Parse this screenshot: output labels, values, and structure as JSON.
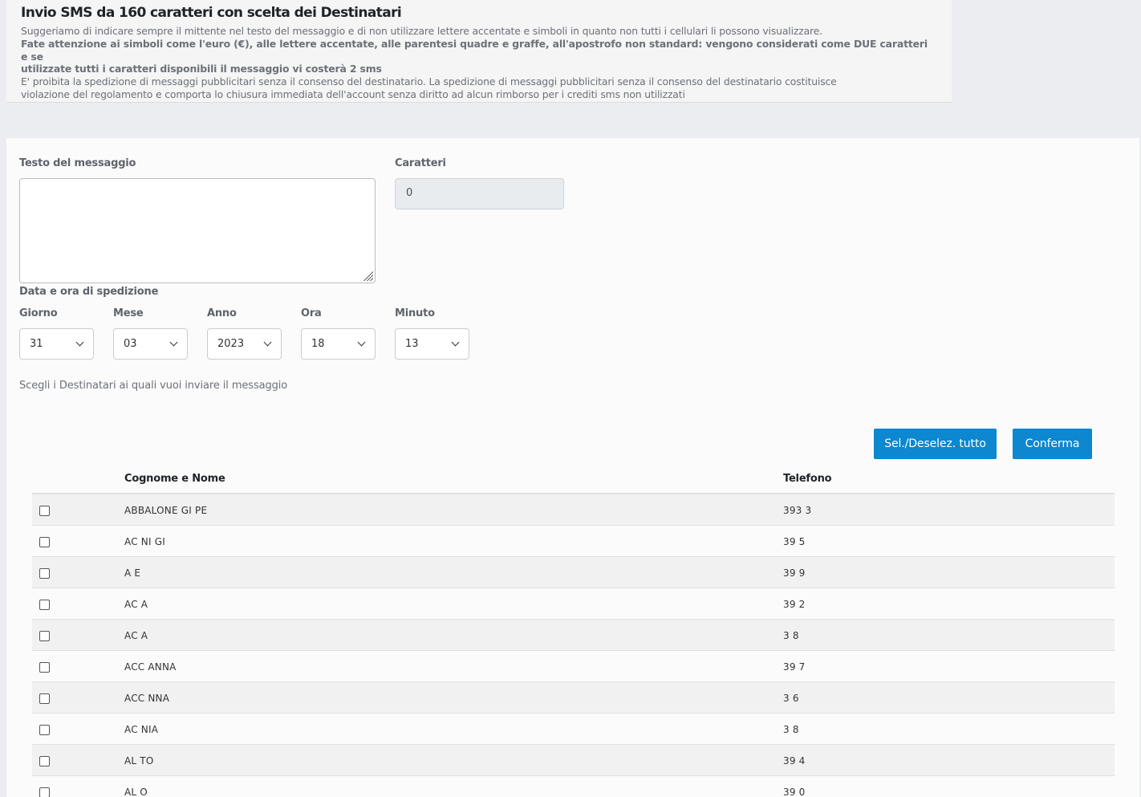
{
  "info": {
    "title": "Invio SMS da 160 caratteri con scelta dei Destinatari",
    "line1": "Suggeriamo di indicare sempre il mittente nel testo del messaggio e di non utilizzare lettere accentate e simboli in quanto non tutti i cellulari li possono visualizzare.",
    "line2": "Fate attenzione ai simboli come l'euro (€), alle lettere accentate, alle parentesi quadre e graffe, all'apostrofo non standard: vengono considerati come DUE caratteri e se",
    "line3": "utilizzate tutti i caratteri disponibili il messaggio vi costerà 2 sms",
    "line4": "E' proibita la spedizione di messaggi pubblicitari senza il consenso del destinatario. La spedizione di messaggi pubblicitari senza il consenso del destinatario costituisce",
    "line5": "violazione del regolamento e comporta lo chiusura immediata dell'account senza diritto ad alcun rimborso per i crediti sms non utilizzati"
  },
  "form": {
    "message_label": "Testo del messaggio",
    "message_value": "",
    "chars_label": "Caratteri",
    "chars_value": "0",
    "schedule_label": "Data e ora di spedizione",
    "day_label": "Giorno",
    "day_value": "31",
    "month_label": "Mese",
    "month_value": "03",
    "year_label": "Anno",
    "year_value": "2023",
    "hour_label": "Ora",
    "hour_value": "18",
    "minute_label": "Minuto",
    "minute_value": "13",
    "recipients_hint": "Scegli i Destinatari ai quali vuoi inviare il messaggio"
  },
  "buttons": {
    "select_all": "Sel./Deselez. tutto",
    "confirm": "Conferma"
  },
  "table": {
    "col_name": "Cognome e Nome",
    "col_phone": "Telefono",
    "rows": [
      {
        "name": "ABBALONE GI   PE",
        "phone": "393     3"
      },
      {
        "name": "AC    NI  GI",
        "phone": "39      5"
      },
      {
        "name": "A          E",
        "phone": "39      9"
      },
      {
        "name": "AC      A",
        "phone": "39      2"
      },
      {
        "name": "AC            A",
        "phone": "3       8"
      },
      {
        "name": "ACC    ANNA",
        "phone": "39      7"
      },
      {
        "name": "ACC    NNA",
        "phone": "3       6"
      },
      {
        "name": "AC        NIA",
        "phone": "3       8"
      },
      {
        "name": "AL      TO",
        "phone": "39      4"
      },
      {
        "name": "AL       O",
        "phone": "39      0"
      }
    ]
  }
}
